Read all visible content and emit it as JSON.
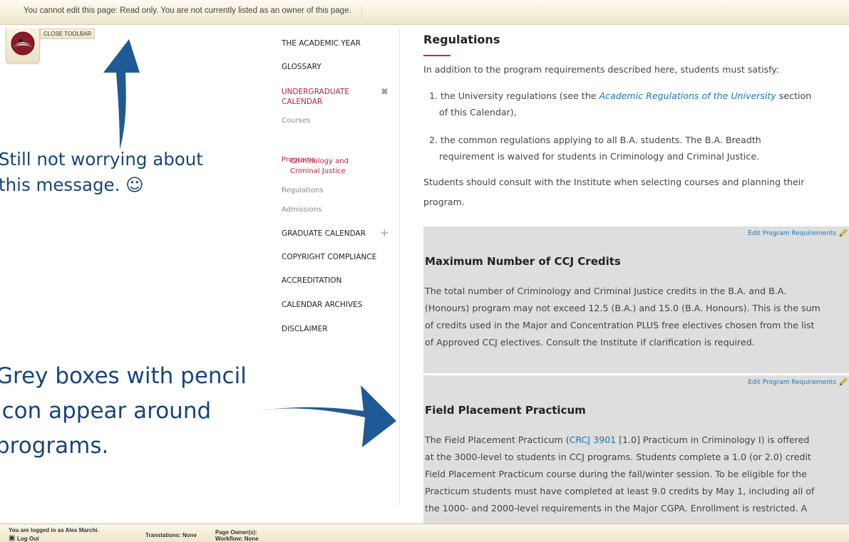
{
  "toolbar": {
    "readonly_message": "You cannot edit this page: Read only. You are not currently listed as an owner of this page.",
    "close_label": "CLOSE TOOLBAR"
  },
  "annotations": {
    "top_line1": "Still not worrying about",
    "top_line2": "this message. ☺",
    "bottom_line1": "Grey boxes with pencil",
    "bottom_line2": "icon appear around",
    "bottom_line3": "programs."
  },
  "nav": {
    "items": [
      {
        "label": "THE ACADEMIC YEAR"
      },
      {
        "label": "GLOSSARY"
      },
      {
        "label": "UNDERGRADUATE CALENDAR"
      },
      {
        "label": "Courses"
      },
      {
        "label": "Programs"
      },
      {
        "label": "Criminology and Criminal Justice"
      },
      {
        "label": "Regulations"
      },
      {
        "label": "Admissions"
      },
      {
        "label": "GRADUATE CALENDAR"
      },
      {
        "label": "COPYRIGHT COMPLIANCE"
      },
      {
        "label": "ACCREDITATION"
      },
      {
        "label": "CALENDAR ARCHIVES"
      },
      {
        "label": "DISCLAIMER"
      }
    ],
    "collapse_icon": "close-icon",
    "expand_icon": "plus-icon"
  },
  "main": {
    "title": "Regulations",
    "intro": "In addition to the program requirements described here, students must satisfy:",
    "list": [
      {
        "num": "1.",
        "pre": "the University regulations (see the ",
        "link": "Academic Regulations of the University",
        "post": " section",
        "line2": "of this Calendar),"
      },
      {
        "num": "2.",
        "pre": "the common regulations applying to all B.A. students. The B.A. Breadth",
        "line2": "requirement is waived for students in Criminology and Criminal Justice."
      }
    ],
    "consult_line1": "Students should consult with the Institute when selecting courses and planning their",
    "consult_line2": "program.",
    "edit_label": "Edit Program Requirements",
    "box1": {
      "heading": "Maximum Number of CCJ Credits",
      "lines": [
        "The total number of Criminology and Criminal Justice credits in the B.A. and B.A.",
        "(Honours) program may not exceed 12.5 (B.A.) and 15.0 (B.A. Honours). This is the sum",
        "of credits used in the Major and Concentration PLUS free electives chosen from the list",
        "of Approved CCJ electives. Consult the Institute if clarification is required."
      ]
    },
    "box2": {
      "heading": "Field Placement Practicum",
      "line1_pre": "The Field Placement Practicum (",
      "line1_link": "CRCJ 3901",
      "line1_post": " [1.0] Practicum in Criminology I) is offered",
      "lines": [
        "at the 3000-level to students in CCJ programs. Students complete a 1.0 (or 2.0) credit",
        "Field Placement Practicum course during the fall/winter session. To be eligible for the",
        "Practicum students must have completed at least 9.0 credits by May 1, including all of",
        "the 1000- and 2000-level requirements in the Major CGPA. Enrollment is restricted. A"
      ]
    }
  },
  "statusbar": {
    "logged_in": "You are logged in as Alex Marchi.",
    "logout": "Log Out",
    "translations": "Translations: None",
    "owners": "Page Owner(s):",
    "workflow": "Workflow: None"
  },
  "colors": {
    "accent_red": "#b5243f",
    "link_blue": "#1b75b4",
    "annotation_blue": "#17457b",
    "grey_box": "#dedede"
  }
}
